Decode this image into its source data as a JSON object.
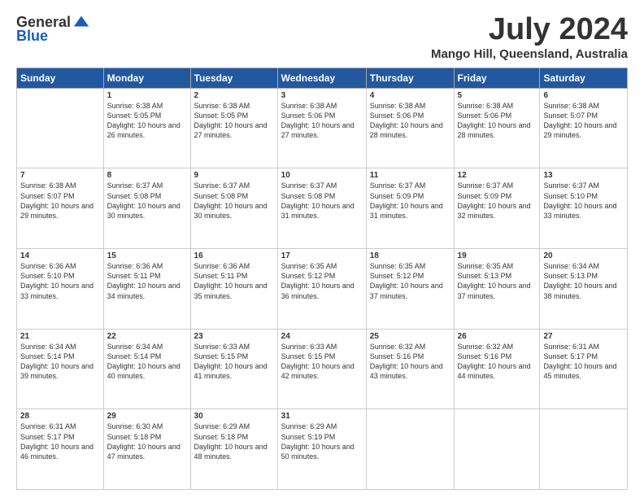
{
  "logo": {
    "general": "General",
    "blue": "Blue"
  },
  "title": "July 2024",
  "subtitle": "Mango Hill, Queensland, Australia",
  "days": [
    "Sunday",
    "Monday",
    "Tuesday",
    "Wednesday",
    "Thursday",
    "Friday",
    "Saturday"
  ],
  "weeks": [
    [
      {
        "num": "",
        "sunrise": "",
        "sunset": "",
        "daylight": ""
      },
      {
        "num": "1",
        "sunrise": "Sunrise: 6:38 AM",
        "sunset": "Sunset: 5:05 PM",
        "daylight": "Daylight: 10 hours and 26 minutes."
      },
      {
        "num": "2",
        "sunrise": "Sunrise: 6:38 AM",
        "sunset": "Sunset: 5:05 PM",
        "daylight": "Daylight: 10 hours and 27 minutes."
      },
      {
        "num": "3",
        "sunrise": "Sunrise: 6:38 AM",
        "sunset": "Sunset: 5:06 PM",
        "daylight": "Daylight: 10 hours and 27 minutes."
      },
      {
        "num": "4",
        "sunrise": "Sunrise: 6:38 AM",
        "sunset": "Sunset: 5:06 PM",
        "daylight": "Daylight: 10 hours and 28 minutes."
      },
      {
        "num": "5",
        "sunrise": "Sunrise: 6:38 AM",
        "sunset": "Sunset: 5:06 PM",
        "daylight": "Daylight: 10 hours and 28 minutes."
      },
      {
        "num": "6",
        "sunrise": "Sunrise: 6:38 AM",
        "sunset": "Sunset: 5:07 PM",
        "daylight": "Daylight: 10 hours and 29 minutes."
      }
    ],
    [
      {
        "num": "7",
        "sunrise": "Sunrise: 6:38 AM",
        "sunset": "Sunset: 5:07 PM",
        "daylight": "Daylight: 10 hours and 29 minutes."
      },
      {
        "num": "8",
        "sunrise": "Sunrise: 6:37 AM",
        "sunset": "Sunset: 5:08 PM",
        "daylight": "Daylight: 10 hours and 30 minutes."
      },
      {
        "num": "9",
        "sunrise": "Sunrise: 6:37 AM",
        "sunset": "Sunset: 5:08 PM",
        "daylight": "Daylight: 10 hours and 30 minutes."
      },
      {
        "num": "10",
        "sunrise": "Sunrise: 6:37 AM",
        "sunset": "Sunset: 5:08 PM",
        "daylight": "Daylight: 10 hours and 31 minutes."
      },
      {
        "num": "11",
        "sunrise": "Sunrise: 6:37 AM",
        "sunset": "Sunset: 5:09 PM",
        "daylight": "Daylight: 10 hours and 31 minutes."
      },
      {
        "num": "12",
        "sunrise": "Sunrise: 6:37 AM",
        "sunset": "Sunset: 5:09 PM",
        "daylight": "Daylight: 10 hours and 32 minutes."
      },
      {
        "num": "13",
        "sunrise": "Sunrise: 6:37 AM",
        "sunset": "Sunset: 5:10 PM",
        "daylight": "Daylight: 10 hours and 33 minutes."
      }
    ],
    [
      {
        "num": "14",
        "sunrise": "Sunrise: 6:36 AM",
        "sunset": "Sunset: 5:10 PM",
        "daylight": "Daylight: 10 hours and 33 minutes."
      },
      {
        "num": "15",
        "sunrise": "Sunrise: 6:36 AM",
        "sunset": "Sunset: 5:11 PM",
        "daylight": "Daylight: 10 hours and 34 minutes."
      },
      {
        "num": "16",
        "sunrise": "Sunrise: 6:36 AM",
        "sunset": "Sunset: 5:11 PM",
        "daylight": "Daylight: 10 hours and 35 minutes."
      },
      {
        "num": "17",
        "sunrise": "Sunrise: 6:35 AM",
        "sunset": "Sunset: 5:12 PM",
        "daylight": "Daylight: 10 hours and 36 minutes."
      },
      {
        "num": "18",
        "sunrise": "Sunrise: 6:35 AM",
        "sunset": "Sunset: 5:12 PM",
        "daylight": "Daylight: 10 hours and 37 minutes."
      },
      {
        "num": "19",
        "sunrise": "Sunrise: 6:35 AM",
        "sunset": "Sunset: 5:13 PM",
        "daylight": "Daylight: 10 hours and 37 minutes."
      },
      {
        "num": "20",
        "sunrise": "Sunrise: 6:34 AM",
        "sunset": "Sunset: 5:13 PM",
        "daylight": "Daylight: 10 hours and 38 minutes."
      }
    ],
    [
      {
        "num": "21",
        "sunrise": "Sunrise: 6:34 AM",
        "sunset": "Sunset: 5:14 PM",
        "daylight": "Daylight: 10 hours and 39 minutes."
      },
      {
        "num": "22",
        "sunrise": "Sunrise: 6:34 AM",
        "sunset": "Sunset: 5:14 PM",
        "daylight": "Daylight: 10 hours and 40 minutes."
      },
      {
        "num": "23",
        "sunrise": "Sunrise: 6:33 AM",
        "sunset": "Sunset: 5:15 PM",
        "daylight": "Daylight: 10 hours and 41 minutes."
      },
      {
        "num": "24",
        "sunrise": "Sunrise: 6:33 AM",
        "sunset": "Sunset: 5:15 PM",
        "daylight": "Daylight: 10 hours and 42 minutes."
      },
      {
        "num": "25",
        "sunrise": "Sunrise: 6:32 AM",
        "sunset": "Sunset: 5:16 PM",
        "daylight": "Daylight: 10 hours and 43 minutes."
      },
      {
        "num": "26",
        "sunrise": "Sunrise: 6:32 AM",
        "sunset": "Sunset: 5:16 PM",
        "daylight": "Daylight: 10 hours and 44 minutes."
      },
      {
        "num": "27",
        "sunrise": "Sunrise: 6:31 AM",
        "sunset": "Sunset: 5:17 PM",
        "daylight": "Daylight: 10 hours and 45 minutes."
      }
    ],
    [
      {
        "num": "28",
        "sunrise": "Sunrise: 6:31 AM",
        "sunset": "Sunset: 5:17 PM",
        "daylight": "Daylight: 10 hours and 46 minutes."
      },
      {
        "num": "29",
        "sunrise": "Sunrise: 6:30 AM",
        "sunset": "Sunset: 5:18 PM",
        "daylight": "Daylight: 10 hours and 47 minutes."
      },
      {
        "num": "30",
        "sunrise": "Sunrise: 6:29 AM",
        "sunset": "Sunset: 5:18 PM",
        "daylight": "Daylight: 10 hours and 48 minutes."
      },
      {
        "num": "31",
        "sunrise": "Sunrise: 6:29 AM",
        "sunset": "Sunset: 5:19 PM",
        "daylight": "Daylight: 10 hours and 50 minutes."
      },
      {
        "num": "",
        "sunrise": "",
        "sunset": "",
        "daylight": ""
      },
      {
        "num": "",
        "sunrise": "",
        "sunset": "",
        "daylight": ""
      },
      {
        "num": "",
        "sunrise": "",
        "sunset": "",
        "daylight": ""
      }
    ]
  ]
}
